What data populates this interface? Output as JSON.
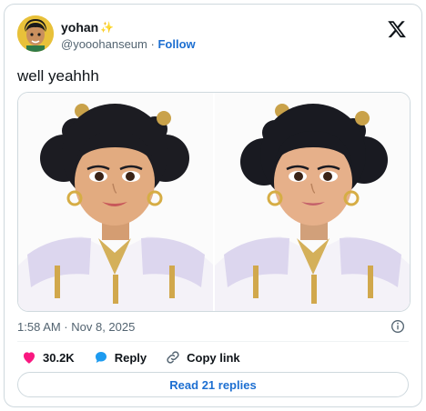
{
  "author": {
    "display_name": "yohan",
    "handle": "@yooohanseum",
    "separator": "·",
    "follow_label": "Follow"
  },
  "tweet": {
    "text": "well yeahhh"
  },
  "media": {
    "images": [
      {
        "name": "character-original"
      },
      {
        "name": "character-edited"
      }
    ]
  },
  "meta": {
    "timestamp": "1:58 AM · Nov 8, 2025"
  },
  "actions": {
    "like_count": "30.2K",
    "reply_label": "Reply",
    "copy_link_label": "Copy link"
  },
  "replies_button": "Read 21 replies",
  "colors": {
    "link": "#1d6fd1",
    "like": "#f91880",
    "reply": "#1d9bf0",
    "muted": "#536471",
    "border": "#cfd9de"
  },
  "icons": [
    "x-logo-icon",
    "info-icon",
    "heart-icon",
    "reply-bubble-icon",
    "link-icon",
    "sparkle-icon"
  ]
}
